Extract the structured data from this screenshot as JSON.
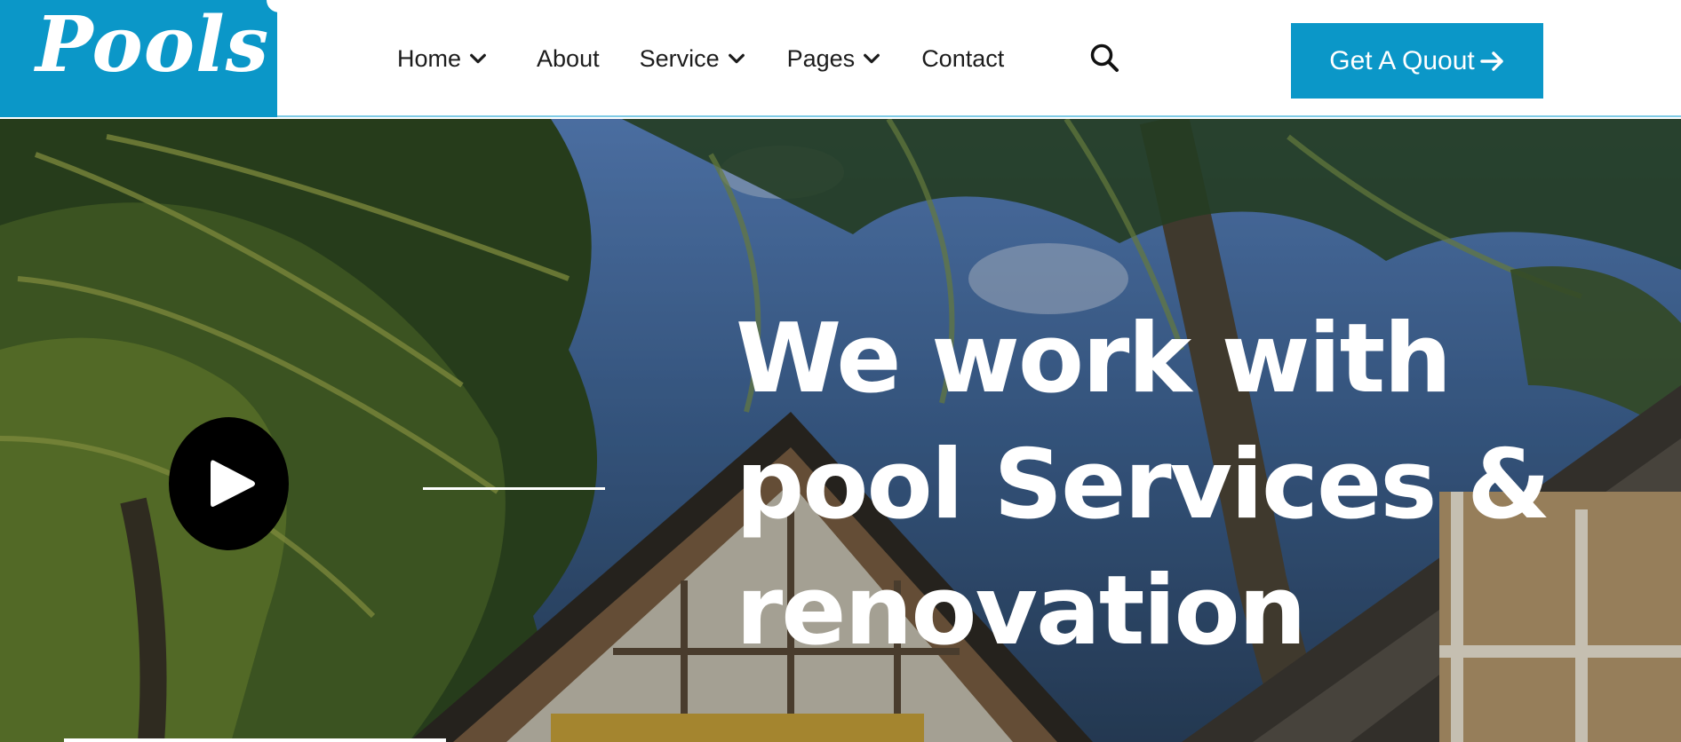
{
  "brand": {
    "logo_text": "Pools",
    "primary_color": "#0b97c8"
  },
  "nav": {
    "items": [
      {
        "label": "Home",
        "has_dropdown": true
      },
      {
        "label": "About",
        "has_dropdown": false
      },
      {
        "label": "Service",
        "has_dropdown": true
      },
      {
        "label": "Pages",
        "has_dropdown": true
      },
      {
        "label": "Contact",
        "has_dropdown": false
      }
    ],
    "search_icon": "search-icon",
    "cta_label": "Get A Quout",
    "cta_icon": "arrow-right-icon"
  },
  "hero": {
    "title_lines": [
      "We work with",
      "pool Services &",
      "renovation"
    ],
    "play_icon": "play-icon"
  }
}
